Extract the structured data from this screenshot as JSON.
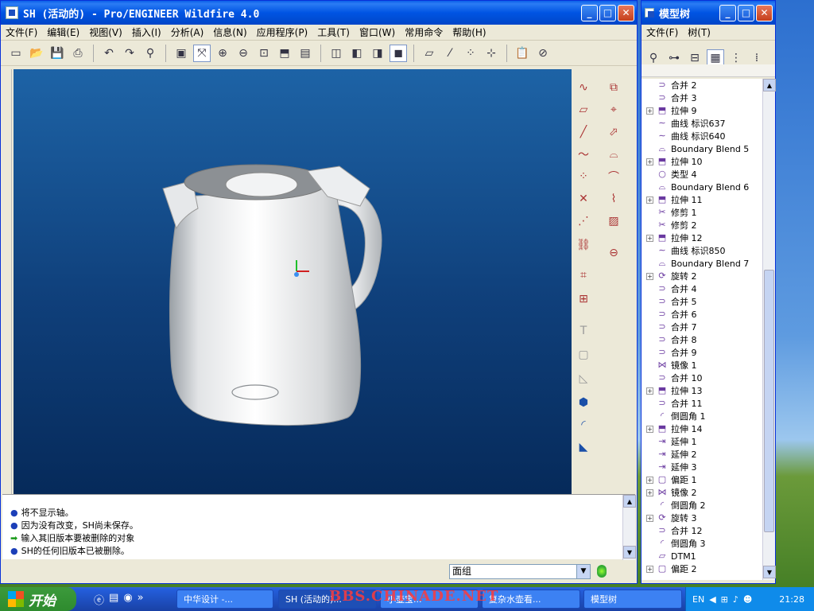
{
  "main_window": {
    "title": "SH (活动的) - Pro/ENGINEER Wildfire 4.0",
    "menus": [
      "文件(F)",
      "编辑(E)",
      "视图(V)",
      "插入(I)",
      "分析(A)",
      "信息(N)",
      "应用程序(P)",
      "工具(T)",
      "窗口(W)",
      "常用命令",
      "帮助(H)"
    ],
    "messages": [
      "将不显示轴。",
      "因为没有改变，SH尚未保存。",
      "输入其旧版本要被删除的对象",
      "SH的任何旧版本已被删除。"
    ],
    "filter_combo": "面组"
  },
  "model_tree": {
    "title": "模型树",
    "menus": [
      "文件(F)",
      "树(T)"
    ],
    "items": [
      {
        "label": "合并 2",
        "expand": false,
        "icon": "merge-icon"
      },
      {
        "label": "合并 3",
        "expand": false,
        "icon": "merge-icon"
      },
      {
        "label": "拉伸 9",
        "expand": true,
        "icon": "extrude-icon"
      },
      {
        "label": "曲线 标识637",
        "expand": false,
        "icon": "curve-icon"
      },
      {
        "label": "曲线 标识640",
        "expand": false,
        "icon": "curve-icon"
      },
      {
        "label": "Boundary Blend 5",
        "expand": false,
        "icon": "blend-icon"
      },
      {
        "label": "拉伸 10",
        "expand": true,
        "icon": "extrude-icon"
      },
      {
        "label": "类型 4",
        "expand": false,
        "icon": "type-icon"
      },
      {
        "label": "Boundary Blend 6",
        "expand": false,
        "icon": "blend-icon"
      },
      {
        "label": "拉伸 11",
        "expand": true,
        "icon": "extrude-icon"
      },
      {
        "label": "修剪 1",
        "expand": false,
        "icon": "trim-icon"
      },
      {
        "label": "修剪 2",
        "expand": false,
        "icon": "trim-icon"
      },
      {
        "label": "拉伸 12",
        "expand": true,
        "icon": "extrude-icon"
      },
      {
        "label": "曲线 标识850",
        "expand": false,
        "icon": "curve-icon"
      },
      {
        "label": "Boundary Blend 7",
        "expand": false,
        "icon": "blend-icon"
      },
      {
        "label": "旋转 2",
        "expand": true,
        "icon": "revolve-icon"
      },
      {
        "label": "合并 4",
        "expand": false,
        "icon": "merge-icon"
      },
      {
        "label": "合并 5",
        "expand": false,
        "icon": "merge-icon"
      },
      {
        "label": "合并 6",
        "expand": false,
        "icon": "merge-icon"
      },
      {
        "label": "合并 7",
        "expand": false,
        "icon": "merge-icon"
      },
      {
        "label": "合并 8",
        "expand": false,
        "icon": "merge-icon"
      },
      {
        "label": "合并 9",
        "expand": false,
        "icon": "merge-icon"
      },
      {
        "label": "镜像 1",
        "expand": false,
        "icon": "mirror-icon"
      },
      {
        "label": "合并 10",
        "expand": false,
        "icon": "merge-icon"
      },
      {
        "label": "拉伸 13",
        "expand": true,
        "icon": "extrude-icon"
      },
      {
        "label": "合并 11",
        "expand": false,
        "icon": "merge-icon"
      },
      {
        "label": "倒圆角 1",
        "expand": false,
        "icon": "round-icon"
      },
      {
        "label": "拉伸 14",
        "expand": true,
        "icon": "extrude-icon"
      },
      {
        "label": "延伸 1",
        "expand": false,
        "icon": "extend-icon"
      },
      {
        "label": "延伸 2",
        "expand": false,
        "icon": "extend-icon"
      },
      {
        "label": "延伸 3",
        "expand": false,
        "icon": "extend-icon"
      },
      {
        "label": "偏距 1",
        "expand": true,
        "icon": "offset-icon"
      },
      {
        "label": "镜像 2",
        "expand": true,
        "icon": "mirror-icon"
      },
      {
        "label": "倒圆角 2",
        "expand": false,
        "icon": "round-icon"
      },
      {
        "label": "旋转 3",
        "expand": true,
        "icon": "revolve-icon"
      },
      {
        "label": "合并 12",
        "expand": false,
        "icon": "merge-icon"
      },
      {
        "label": "倒圆角 3",
        "expand": false,
        "icon": "round-icon"
      },
      {
        "label": "DTM1",
        "expand": false,
        "icon": "datum-plane-icon"
      },
      {
        "label": "偏距 2",
        "expand": true,
        "icon": "offset-icon"
      }
    ]
  },
  "taskbar": {
    "start": "开始",
    "tasks": [
      "中华设计 -...",
      "SH (活动的)...",
      "小壶宝...",
      "复杂水壶看...",
      "模型树"
    ],
    "watermark": "BBS.CHINADE.NET",
    "tray_lang": "EN",
    "clock": "21:28"
  },
  "colors": {
    "viewport_top": "#1d63a6",
    "viewport_bottom": "#062a5a",
    "title_blue": "#0054e3",
    "accent": "#1c3fb8"
  }
}
